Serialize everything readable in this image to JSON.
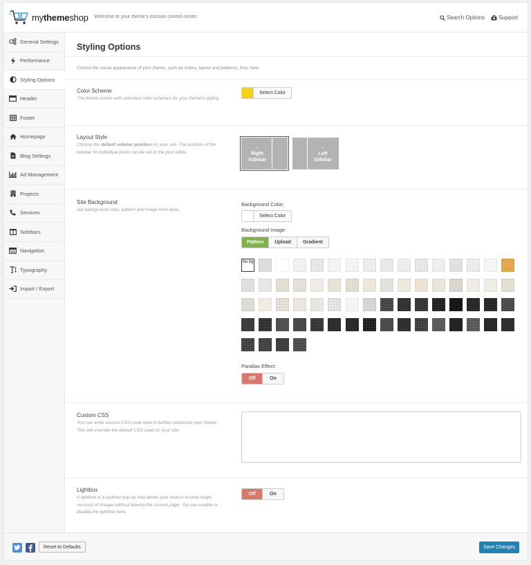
{
  "header": {
    "logo_text_regular": "my",
    "logo_text_bold": "theme",
    "logo_text_end": "shop",
    "tagline": "Welcome to your theme's mission control center.",
    "search_label": "Search Options",
    "support_label": "Support"
  },
  "sidebar": {
    "items": [
      {
        "label": "General Settings",
        "icon": "gears-icon"
      },
      {
        "label": "Performance",
        "icon": "bolt-icon"
      },
      {
        "label": "Styling Options",
        "icon": "half-circle-icon"
      },
      {
        "label": "Header",
        "icon": "header-icon"
      },
      {
        "label": "Footer",
        "icon": "table-icon"
      },
      {
        "label": "Homepage",
        "icon": "home-icon"
      },
      {
        "label": "Blog Settings",
        "icon": "document-icon"
      },
      {
        "label": "Ad Management",
        "icon": "bar-chart-icon"
      },
      {
        "label": "Projects",
        "icon": "building-icon"
      },
      {
        "label": "Services",
        "icon": "phone-icon"
      },
      {
        "label": "Sidebars",
        "icon": "columns-icon"
      },
      {
        "label": "Navigation",
        "icon": "navigation-icon"
      },
      {
        "label": "Typography",
        "icon": "text-height-icon"
      },
      {
        "label": "Import / Export",
        "icon": "sign-in-icon"
      }
    ],
    "active_index": 2
  },
  "main": {
    "title": "Styling Options",
    "intro": "Control the visual appearance of your theme, such as colors, layout and patterns, from here.",
    "color_scheme": {
      "title": "Color Scheme",
      "desc": "The theme comes with unlimited color schemes for your theme's styling.",
      "button": "Select Color",
      "value": "#f7d30d"
    },
    "layout_style": {
      "title": "Layout Style",
      "desc_before": "Choose the ",
      "desc_bold": "default sidebar position",
      "desc_after": " for your site. The position of the sidebar for individual posts can be set in the post editor.",
      "right_arrow": "→",
      "right_line1": "Right",
      "right_line2": "Sidebar",
      "left_arrow": "←",
      "left_line1": "Left",
      "left_line2": "Sidebar",
      "selected": "right"
    },
    "site_background": {
      "title": "Site Background",
      "desc": "Set background color, pattern and image from here.",
      "bg_color_label": "Background Color:",
      "bg_color_button": "Select Color",
      "bg_image_label": "Background Image:",
      "image_tabs": [
        "Pattern",
        "Upload",
        "Gradient"
      ],
      "active_image_tab": "Pattern",
      "no_bg_label": "No bg",
      "parallax_label": "Parallax Effect:",
      "parallax_options": [
        "Off",
        "On"
      ],
      "parallax_value": "Off"
    },
    "custom_css": {
      "title": "Custom CSS",
      "desc": "You can enter custom CSS code here to further customize your theme. This will override the default CSS used on your site.",
      "value": ""
    },
    "lightbox": {
      "title": "Lightbox",
      "desc": "A lightbox is a stylized pop-up that allows your visitors to view larger versions of images without leaving the current page. You can enable or disable the lightbox here.",
      "options": [
        "Off",
        "On"
      ],
      "value": "Off"
    }
  },
  "footer": {
    "reset_label": "Reset to Defaults",
    "save_label": "Save Changes",
    "twitter_color": "#4a90d9",
    "facebook_color": "#3b5998"
  },
  "patterns": [
    "nobg",
    "#e2e2e2",
    "#ffffff",
    "#f4f4f4",
    "#ededed",
    "#f3f3f3",
    "#f6f6f6",
    "#f2f2f2",
    "#e8e8e8",
    "#f0f0f0",
    "#ececec",
    "#efefef",
    "#e4e4e4",
    "#f1f1f1",
    "#f5f5f5",
    "#e9a94a",
    "#e5e5e5",
    "#e7e7e7",
    "#e6e1d4",
    "#e9e6de",
    "#efece4",
    "#ebe6da",
    "#e7e2d6",
    "#ece7d9",
    "#e7e4dc",
    "#f3efe3",
    "#ebe3d3",
    "#eee8da",
    "#dfdcd3",
    "#efece6",
    "#f2efe6",
    "#e9e4d6",
    "#dddbd3",
    "#f3efe4",
    "#e9e5da",
    "#eae6de",
    "#ece9e3",
    "#e8e8e8",
    "#f4f4f4",
    "#d8d8d8",
    "#424242",
    "#333333",
    "#363636",
    "#1d1d1d",
    "#181818",
    "#262626",
    "#222222",
    "#4d4d4d",
    "#3a3a3a",
    "#2e2e2e",
    "#525252",
    "#474747",
    "#333333",
    "#2f2f2f",
    "#272727",
    "#1c1c1c",
    "#4c4c4c",
    "#2d2d2d",
    "#3b3b3b",
    "#5c5c5c",
    "#1f1f1f",
    "#555555",
    "#2a2a2a",
    "#2b2b2b",
    "#3d3d3d",
    "#454545",
    "#3c3c3c",
    "#494949"
  ]
}
